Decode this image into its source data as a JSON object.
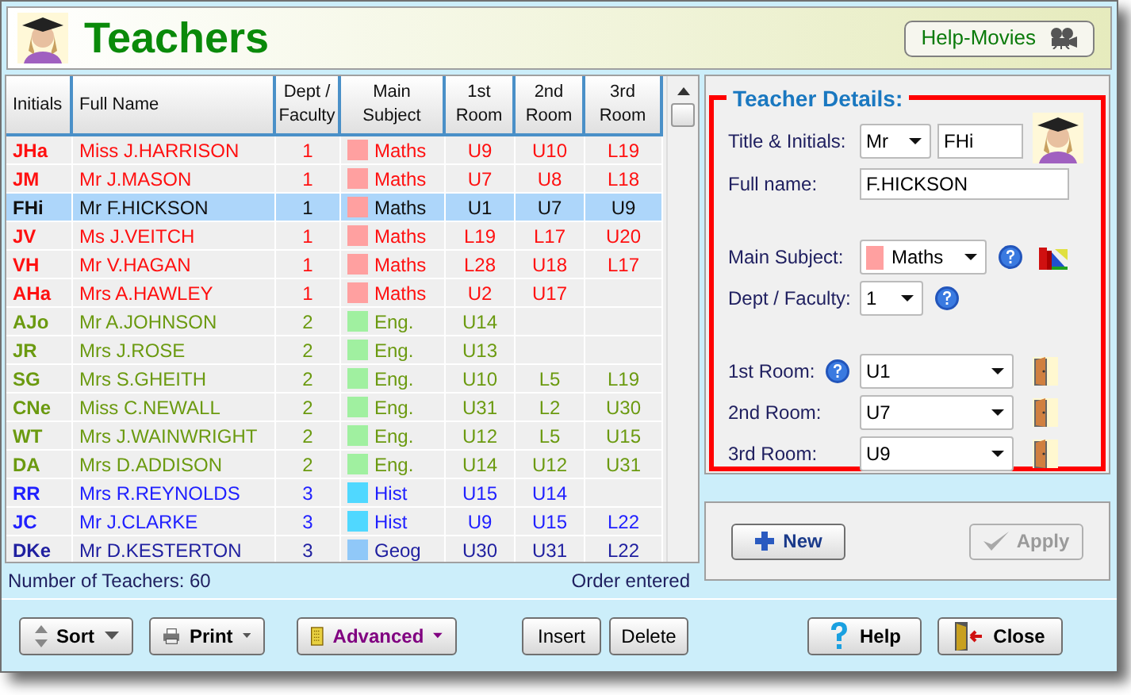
{
  "window": {
    "title": "Teachers"
  },
  "help_movies_button": "Help-Movies",
  "table": {
    "columns": [
      "Initials",
      "Full Name",
      "Dept / Faculty",
      "Main Subject",
      "1st Room",
      "2nd Room",
      "3rd Room"
    ],
    "rows": [
      {
        "initials": "JHa",
        "name": "Miss J.HARRISON",
        "dept": "1",
        "subject": {
          "label": "Maths",
          "color": "#ffa0a0"
        },
        "rooms": [
          "U9",
          "U10",
          "L19"
        ],
        "color": "#ff1010",
        "selected": false
      },
      {
        "initials": "JM",
        "name": "Mr J.MASON",
        "dept": "1",
        "subject": {
          "label": "Maths",
          "color": "#ffa0a0"
        },
        "rooms": [
          "U7",
          "U8",
          "L18"
        ],
        "color": "#ff1010",
        "selected": false
      },
      {
        "initials": "FHi",
        "name": "Mr F.HICKSON",
        "dept": "1",
        "subject": {
          "label": "Maths",
          "color": "#ffa0a0"
        },
        "rooms": [
          "U1",
          "U7",
          "U9"
        ],
        "selected": true
      },
      {
        "initials": "JV",
        "name": "Ms J.VEITCH",
        "dept": "1",
        "subject": {
          "label": "Maths",
          "color": "#ffa0a0"
        },
        "rooms": [
          "L19",
          "L17",
          "U20"
        ],
        "color": "#ff1010",
        "selected": false
      },
      {
        "initials": "VH",
        "name": "Mr V.HAGAN",
        "dept": "1",
        "subject": {
          "label": "Maths",
          "color": "#ffa0a0"
        },
        "rooms": [
          "L28",
          "U18",
          "L17"
        ],
        "color": "#ff1010",
        "selected": false
      },
      {
        "initials": "AHa",
        "name": "Mrs A.HAWLEY",
        "dept": "1",
        "subject": {
          "label": "Maths",
          "color": "#ffa0a0"
        },
        "rooms": [
          "U2",
          "U17"
        ],
        "color": "#ff1010",
        "selected": false
      },
      {
        "initials": "AJo",
        "name": "Mr A.JOHNSON",
        "dept": "2",
        "subject": {
          "label": "Eng.",
          "color": "#a0f0a0"
        },
        "rooms": [
          "U14"
        ],
        "color": "#6b9a10",
        "selected": false
      },
      {
        "initials": "JR",
        "name": "Mrs J.ROSE",
        "dept": "2",
        "subject": {
          "label": "Eng.",
          "color": "#a0f0a0"
        },
        "rooms": [
          "U13"
        ],
        "color": "#6b9a10",
        "selected": false
      },
      {
        "initials": "SG",
        "name": "Mrs S.GHEITH",
        "dept": "2",
        "subject": {
          "label": "Eng.",
          "color": "#a0f0a0"
        },
        "rooms": [
          "U10",
          "L5",
          "L19"
        ],
        "color": "#6b9a10",
        "selected": false
      },
      {
        "initials": "CNe",
        "name": "Miss C.NEWALL",
        "dept": "2",
        "subject": {
          "label": "Eng.",
          "color": "#a0f0a0"
        },
        "rooms": [
          "U31",
          "L2",
          "U30"
        ],
        "color": "#6b9a10",
        "selected": false
      },
      {
        "initials": "WT",
        "name": "Mrs J.WAINWRIGHT",
        "dept": "2",
        "subject": {
          "label": "Eng.",
          "color": "#a0f0a0"
        },
        "rooms": [
          "U12",
          "L5",
          "U15"
        ],
        "color": "#6b9a10",
        "selected": false
      },
      {
        "initials": "DA",
        "name": "Mrs D.ADDISON",
        "dept": "2",
        "subject": {
          "label": "Eng.",
          "color": "#a0f0a0"
        },
        "rooms": [
          "U14",
          "U12",
          "U31"
        ],
        "color": "#6b9a10",
        "selected": false
      },
      {
        "initials": "RR",
        "name": "Mrs R.REYNOLDS",
        "dept": "3",
        "subject": {
          "label": "Hist",
          "color": "#50d8ff"
        },
        "rooms": [
          "U15",
          "U14"
        ],
        "color": "#2020ff",
        "selected": false
      },
      {
        "initials": "JC",
        "name": "Mr J.CLARKE",
        "dept": "3",
        "subject": {
          "label": "Hist",
          "color": "#50d8ff"
        },
        "rooms": [
          "U9",
          "U15",
          "L22"
        ],
        "color": "#2020ff",
        "selected": false
      },
      {
        "initials": "DKe",
        "name": "Mr D.KESTERTON",
        "dept": "3",
        "subject": {
          "label": "Geog",
          "color": "#90c8f8"
        },
        "rooms": [
          "U30",
          "U31",
          "L22"
        ],
        "color": "#2020a0",
        "selected": false
      }
    ]
  },
  "status_bar": {
    "count": "Number of Teachers: 60",
    "order": "Order entered"
  },
  "details": {
    "title": "Teacher Details:",
    "title_label": "Title & Initials:",
    "title_value": "Mr",
    "initials_value": "FHi",
    "fullname_label": "Full name:",
    "fullname_value": "F.HICKSON",
    "subject": {
      "label": "Main Subject:",
      "value": "Maths",
      "color": "#ffa0a0"
    },
    "dept_label": "Dept / Faculty:",
    "dept_value": "1",
    "rooms": [
      {
        "label": "1st Room:",
        "value": "U1",
        "help": true
      },
      {
        "label": "2nd Room:",
        "value": "U7",
        "help": false
      },
      {
        "label": "3rd Room:",
        "value": "U9",
        "help": false
      }
    ]
  },
  "new_button": "New",
  "apply_button": {
    "label": "Apply",
    "disabled": true
  },
  "toolbar": [
    {
      "kind": "sort",
      "label": "Sort"
    },
    {
      "kind": "print",
      "label": "Print"
    },
    {
      "kind": "advanced",
      "label": "Advanced"
    },
    {
      "kind": "plain",
      "label": "Insert"
    },
    {
      "kind": "plain",
      "label": "Delete"
    },
    {
      "kind": "help",
      "label": "Help"
    },
    {
      "kind": "close",
      "label": "Close"
    }
  ]
}
